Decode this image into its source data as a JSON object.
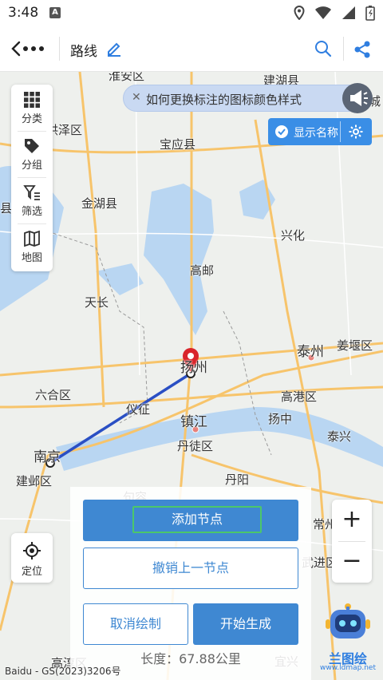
{
  "status": {
    "time": "3:48",
    "badge": "A"
  },
  "appbar": {
    "title": "路线"
  },
  "tip": {
    "text": "如何更换标注的图标颜色样式"
  },
  "show_names": {
    "label": "显示名称"
  },
  "tools": [
    {
      "label": "分类",
      "icon": "grid-icon"
    },
    {
      "label": "分组",
      "icon": "tag-icon"
    },
    {
      "label": "筛选",
      "icon": "filter-icon"
    },
    {
      "label": "地图",
      "icon": "map-icon"
    }
  ],
  "locate": {
    "label": "定位"
  },
  "zoom": {
    "in": "+",
    "out": "−"
  },
  "actions": {
    "add_node": "添加节点",
    "undo_node": "撤销上一节点",
    "cancel": "取消绘制",
    "generate": "开始生成"
  },
  "length_text": "长度：67.88公里",
  "copyright": "Baidu - GS(2023)3206号",
  "logo": {
    "brand": "兰图绘",
    "url": "www.ldmap.net"
  },
  "map_labels": [
    "淮安区",
    "建湖县",
    "洪泽区",
    "宝应县",
    "金湖县",
    "兴化",
    "高邮",
    "天长",
    "泰州",
    "姜堰区",
    "扬州",
    "六合区",
    "仪征",
    "镇江",
    "高港区",
    "扬中",
    "泰兴",
    "南京",
    "丹徒区",
    "建邺区",
    "丹阳",
    "句容",
    "常州",
    "武进区",
    "高淳区",
    "宜兴",
    "城",
    "县"
  ],
  "colors": {
    "primary": "#3f88d2",
    "route": "#2a4fc4",
    "pin": "#d9242a"
  }
}
